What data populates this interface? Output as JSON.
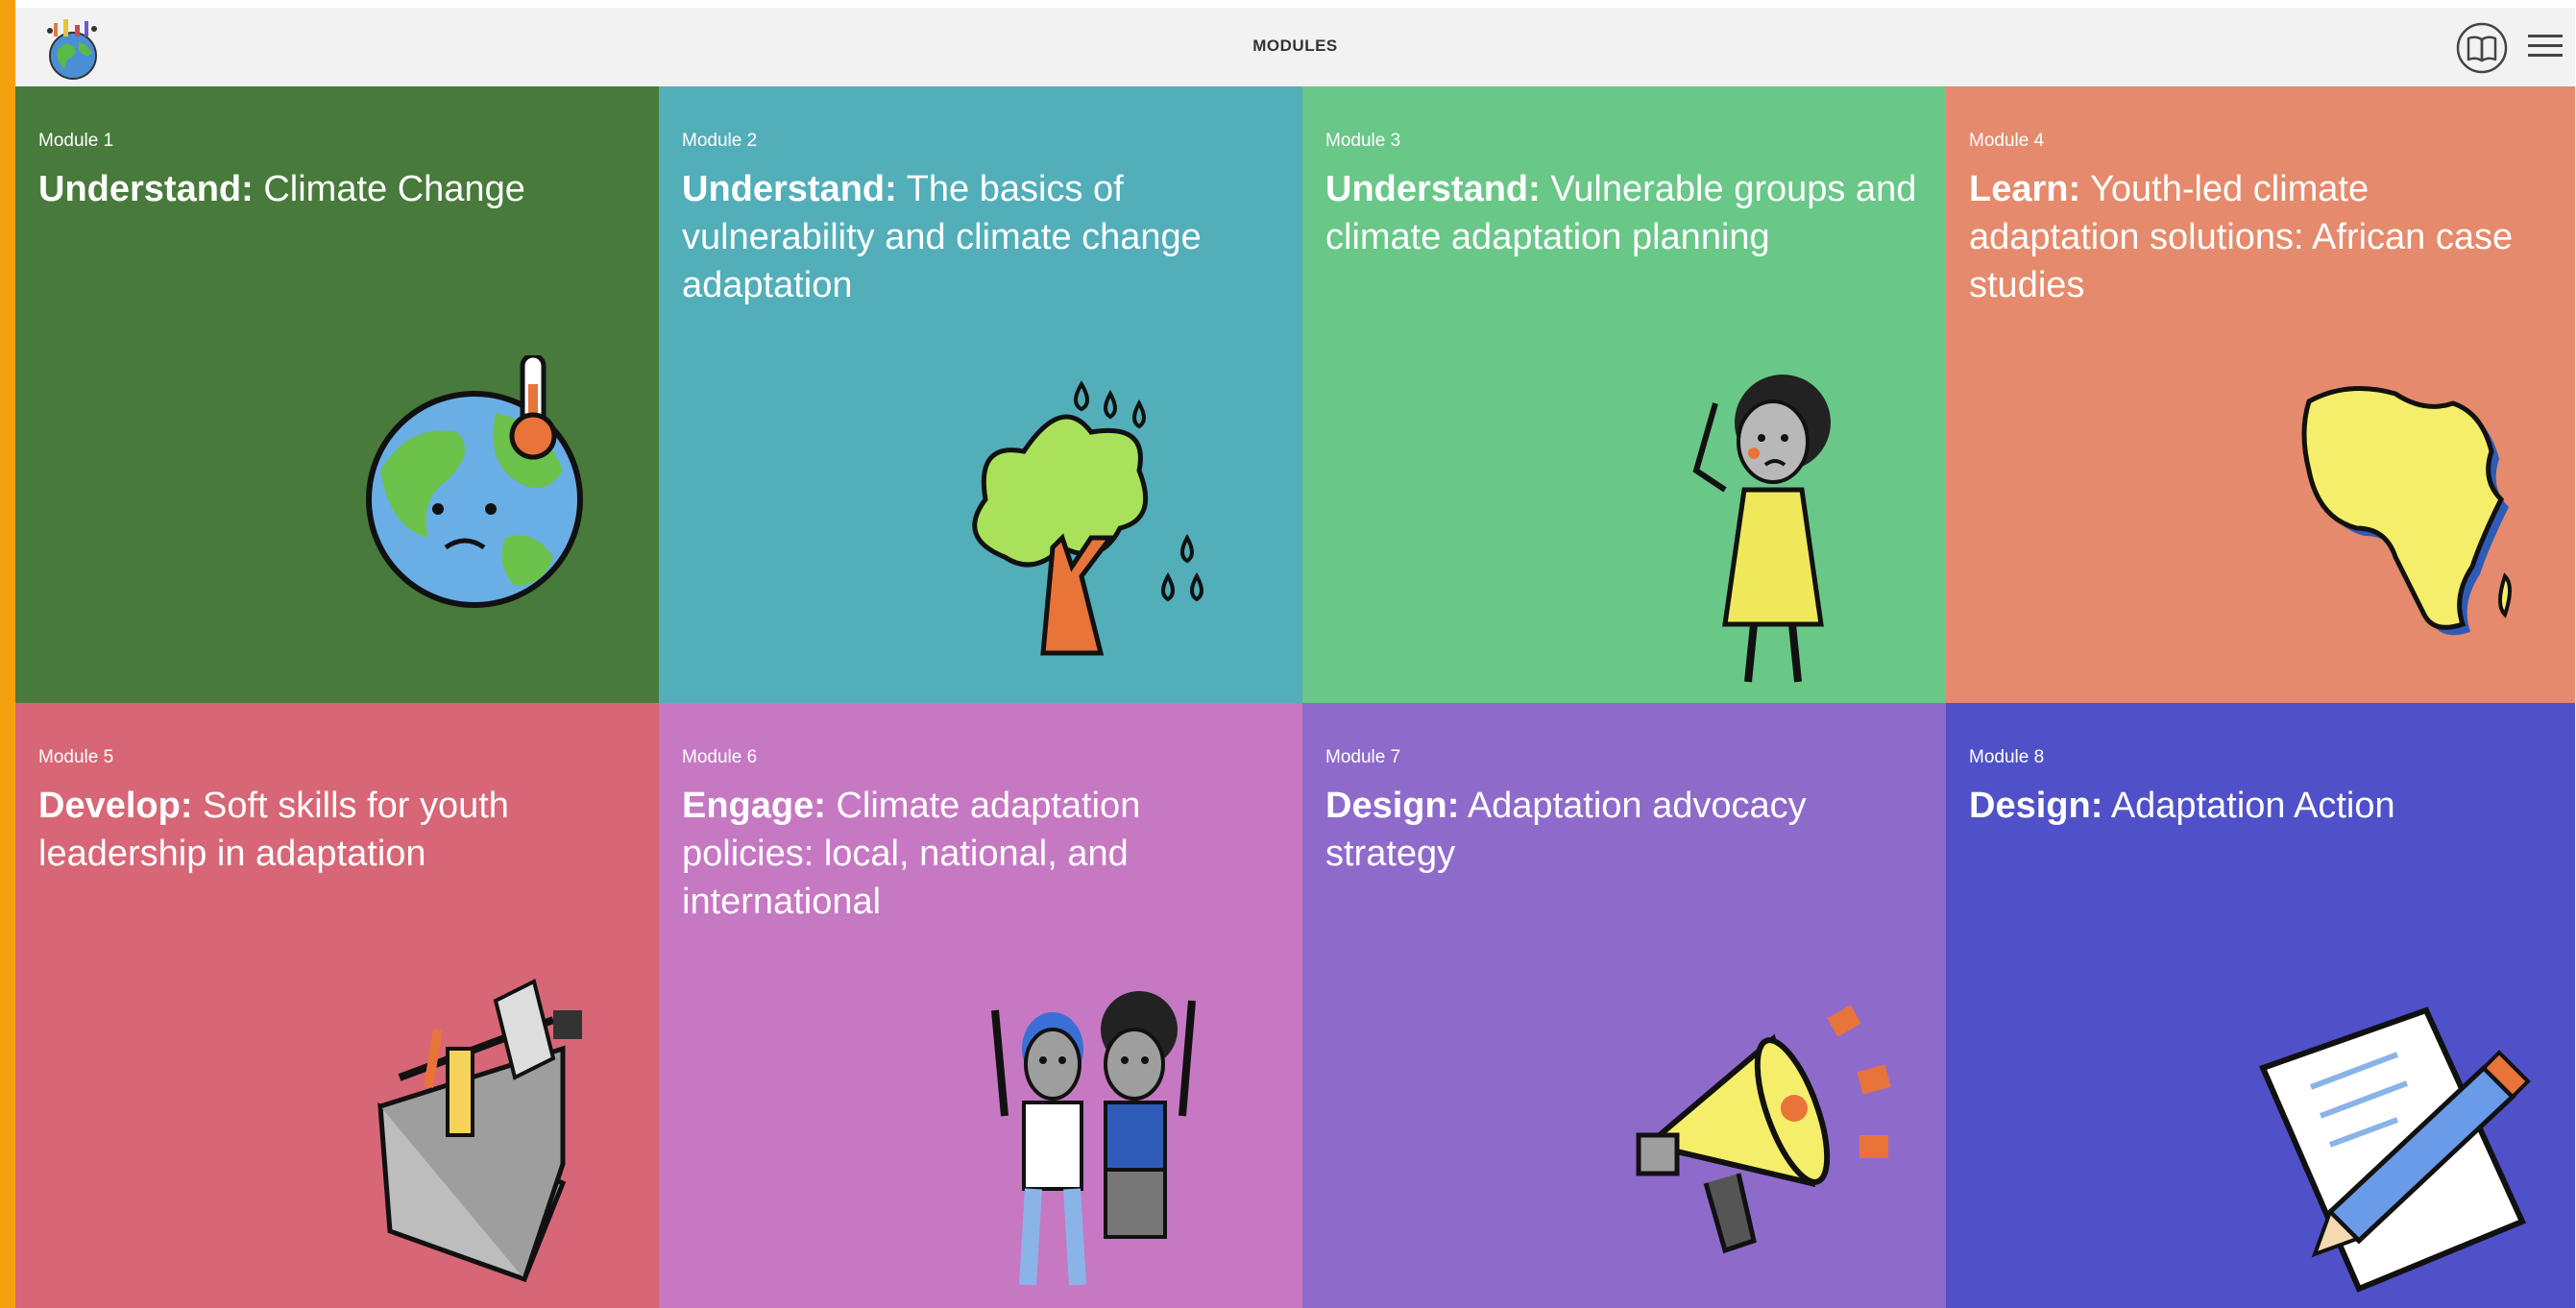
{
  "header": {
    "title": "MODULES"
  },
  "modules": [
    {
      "number": "Module 1",
      "verb": "Understand:",
      "title": " Climate Change",
      "color": "#487a3b",
      "icon": "globe-thermometer-icon"
    },
    {
      "number": "Module 2",
      "verb": "Understand:",
      "title": " The basics of vulnerability and climate change adaptation",
      "color": "#52aeb9",
      "icon": "tree-rain-icon"
    },
    {
      "number": "Module 3",
      "verb": "Understand:",
      "title": " Vulnerable groups and climate adaptation planning",
      "color": "#69c788",
      "icon": "worried-woman-icon"
    },
    {
      "number": "Module 4",
      "verb": "Learn:",
      "title": " Youth-led climate adaptation solutions: African case studies",
      "color": "#e58a6c",
      "icon": "africa-map-icon"
    },
    {
      "number": "Module 5",
      "verb": "Develop:",
      "title": " Soft skills for youth leadership in adaptation",
      "color": "#d76676",
      "icon": "toolbox-icon"
    },
    {
      "number": "Module 6",
      "verb": "Engage:",
      "title": " Climate adaptation policies: local, national, and international",
      "color": "#c678c3",
      "icon": "two-people-icon"
    },
    {
      "number": "Module 7",
      "verb": "Design:",
      "title": " Adaptation advocacy strategy",
      "color": "#8e6bcb",
      "icon": "megaphone-icon"
    },
    {
      "number": "Module 8",
      "verb": "Design:",
      "title": " Adaptation Action",
      "color": "#5051c9",
      "icon": "paper-pencil-icon"
    }
  ]
}
